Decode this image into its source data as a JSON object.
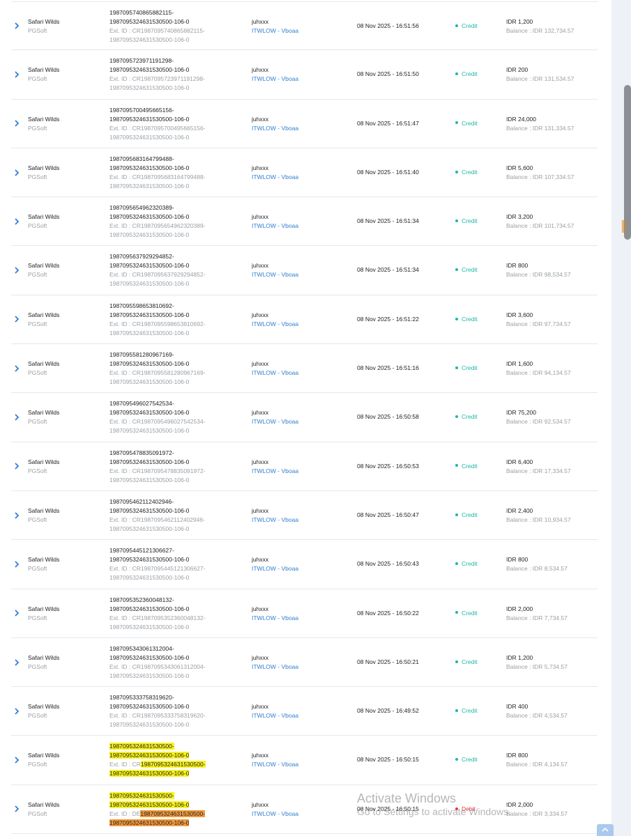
{
  "transactions": [
    {
      "game": "Safari Wilds",
      "provider": "PGSoft",
      "tx_id_1": "1987095740865882115-",
      "tx_id_2": "1987095324631530500-106-0",
      "ext_prefix": "Ext. ID : ",
      "ext_1": "CR1987095740865882115-",
      "ext_2": "1987095324631530500-106-0",
      "user": "juhxxx",
      "agent": "ITWLOW - Vboaa",
      "date": "08 Nov 2025 - 16:51:56",
      "type": "Credit",
      "amount": "IDR 1,200",
      "balance": "Balance : IDR 132,734.57"
    },
    {
      "game": "Safari Wilds",
      "provider": "PGSoft",
      "tx_id_1": "1987095723971191298-",
      "tx_id_2": "1987095324631530500-106-0",
      "ext_prefix": "Ext. ID : ",
      "ext_1": "CR1987095723971191298-",
      "ext_2": "1987095324631530500-106-0",
      "user": "juhxxx",
      "agent": "ITWLOW - Vboaa",
      "date": "08 Nov 2025 - 16:51:50",
      "type": "Credit",
      "amount": "IDR 200",
      "balance": "Balance : IDR 131,534.57"
    },
    {
      "game": "Safari Wilds",
      "provider": "PGSoft",
      "tx_id_1": "1987095700495665156-",
      "tx_id_2": "1987095324631530500-106-0",
      "ext_prefix": "Ext. ID : ",
      "ext_1": "CR1987095700495665156-",
      "ext_2": "1987095324631530500-106-0",
      "user": "juhxxx",
      "agent": "ITWLOW - Vboaa",
      "date": "08 Nov 2025 - 16:51:47",
      "type": "Credit",
      "amount": "IDR 24,000",
      "balance": "Balance : IDR 131,334.57"
    },
    {
      "game": "Safari Wilds",
      "provider": "PGSoft",
      "tx_id_1": "1987095683164799488-",
      "tx_id_2": "1987095324631530500-106-0",
      "ext_prefix": "Ext. ID : ",
      "ext_1": "CR1987095683164799488-",
      "ext_2": "1987095324631530500-106-0",
      "user": "juhxxx",
      "agent": "ITWLOW - Vboaa",
      "date": "08 Nov 2025 - 16:51:40",
      "type": "Credit",
      "amount": "IDR 5,600",
      "balance": "Balance : IDR 107,334.57"
    },
    {
      "game": "Safari Wilds",
      "provider": "PGSoft",
      "tx_id_1": "1987095654962320389-",
      "tx_id_2": "1987095324631530500-106-0",
      "ext_prefix": "Ext. ID : ",
      "ext_1": "CR1987095654962320389-",
      "ext_2": "1987095324631530500-106-0",
      "user": "juhxxx",
      "agent": "ITWLOW - Vboaa",
      "date": "08 Nov 2025 - 16:51:34",
      "type": "Credit",
      "amount": "IDR 3,200",
      "balance": "Balance : IDR 101,734.57"
    },
    {
      "game": "Safari Wilds",
      "provider": "PGSoft",
      "tx_id_1": "1987095637929294852-",
      "tx_id_2": "1987095324631530500-106-0",
      "ext_prefix": "Ext. ID : ",
      "ext_1": "CR1987095637929294852-",
      "ext_2": "1987095324631530500-106-0",
      "user": "juhxxx",
      "agent": "ITWLOW - Vboaa",
      "date": "08 Nov 2025 - 16:51:34",
      "type": "Credit",
      "amount": "IDR 800",
      "balance": "Balance : IDR 98,534.57"
    },
    {
      "game": "Safari Wilds",
      "provider": "PGSoft",
      "tx_id_1": "1987095598653810692-",
      "tx_id_2": "1987095324631530500-106-0",
      "ext_prefix": "Ext. ID : ",
      "ext_1": "CR1987095598653810692-",
      "ext_2": "1987095324631530500-106-0",
      "user": "juhxxx",
      "agent": "ITWLOW - Vboaa",
      "date": "08 Nov 2025 - 16:51:22",
      "type": "Credit",
      "amount": "IDR 3,600",
      "balance": "Balance : IDR 97,734.57"
    },
    {
      "game": "Safari Wilds",
      "provider": "PGSoft",
      "tx_id_1": "1987095581280967169-",
      "tx_id_2": "1987095324631530500-106-0",
      "ext_prefix": "Ext. ID : ",
      "ext_1": "CR1987095581280967169-",
      "ext_2": "1987095324631530500-106-0",
      "user": "juhxxx",
      "agent": "ITWLOW - Vboaa",
      "date": "08 Nov 2025 - 16:51:16",
      "type": "Credit",
      "amount": "IDR 1,600",
      "balance": "Balance : IDR 94,134.57"
    },
    {
      "game": "Safari Wilds",
      "provider": "PGSoft",
      "tx_id_1": "1987095496027542534-",
      "tx_id_2": "1987095324631530500-106-0",
      "ext_prefix": "Ext. ID : ",
      "ext_1": "CR1987095496027542534-",
      "ext_2": "1987095324631530500-106-0",
      "user": "juhxxx",
      "agent": "ITWLOW - Vboaa",
      "date": "08 Nov 2025 - 16:50:58",
      "type": "Credit",
      "amount": "IDR 75,200",
      "balance": "Balance : IDR 92,534.57"
    },
    {
      "game": "Safari Wilds",
      "provider": "PGSoft",
      "tx_id_1": "1987095478835091972-",
      "tx_id_2": "1987095324631530500-106-0",
      "ext_prefix": "Ext. ID : ",
      "ext_1": "CR1987095478835091972-",
      "ext_2": "1987095324631530500-106-0",
      "user": "juhxxx",
      "agent": "ITWLOW - Vboaa",
      "date": "08 Nov 2025 - 16:50:53",
      "type": "Credit",
      "amount": "IDR 6,400",
      "balance": "Balance : IDR 17,334.57"
    },
    {
      "game": "Safari Wilds",
      "provider": "PGSoft",
      "tx_id_1": "1987095462112402946-",
      "tx_id_2": "1987095324631530500-106-0",
      "ext_prefix": "Ext. ID : ",
      "ext_1": "CR1987095462112402946-",
      "ext_2": "1987095324631530500-106-0",
      "user": "juhxxx",
      "agent": "ITWLOW - Vboaa",
      "date": "08 Nov 2025 - 16:50:47",
      "type": "Credit",
      "amount": "IDR 2,400",
      "balance": "Balance : IDR 10,934.57"
    },
    {
      "game": "Safari Wilds",
      "provider": "PGSoft",
      "tx_id_1": "1987095445121306627-",
      "tx_id_2": "1987095324631530500-106-0",
      "ext_prefix": "Ext. ID : ",
      "ext_1": "CR1987095445121306627-",
      "ext_2": "1987095324631530500-106-0",
      "user": "juhxxx",
      "agent": "ITWLOW - Vboaa",
      "date": "08 Nov 2025 - 16:50:43",
      "type": "Credit",
      "amount": "IDR 800",
      "balance": "Balance : IDR 8,534.57"
    },
    {
      "game": "Safari Wilds",
      "provider": "PGSoft",
      "tx_id_1": "1987095352360048132-",
      "tx_id_2": "1987095324631530500-106-0",
      "ext_prefix": "Ext. ID : ",
      "ext_1": "CR1987095352360048132-",
      "ext_2": "1987095324631530500-106-0",
      "user": "juhxxx",
      "agent": "ITWLOW - Vboaa",
      "date": "08 Nov 2025 - 16:50:22",
      "type": "Credit",
      "amount": "IDR 2,000",
      "balance": "Balance : IDR 7,734.57"
    },
    {
      "game": "Safari Wilds",
      "provider": "PGSoft",
      "tx_id_1": "1987095343061312004-",
      "tx_id_2": "1987095324631530500-106-0",
      "ext_prefix": "Ext. ID : ",
      "ext_1": "CR1987095343061312004-",
      "ext_2": "1987095324631530500-106-0",
      "user": "juhxxx",
      "agent": "ITWLOW - Vboaa",
      "date": "08 Nov 2025 - 16:50:21",
      "type": "Credit",
      "amount": "IDR 1,200",
      "balance": "Balance : IDR 5,734.57"
    },
    {
      "game": "Safari Wilds",
      "provider": "PGSoft",
      "tx_id_1": "1987095333758319620-",
      "tx_id_2": "1987095324631530500-106-0",
      "ext_prefix": "Ext. ID : ",
      "ext_1": "CR1987095333758319620-",
      "ext_2": "1987095324631530500-106-0",
      "user": "juhxxx",
      "agent": "ITWLOW - Vboaa",
      "date": "08 Nov 2025 - 16:49:52",
      "type": "Credit",
      "amount": "IDR 400",
      "balance": "Balance : IDR 4,534.57"
    },
    {
      "game": "Safari Wilds",
      "provider": "PGSoft",
      "tx_id_1": "1987095324631530500-",
      "tx_id_2": "1987095324631530500-106-0",
      "ext_prefix": "Ext. ID : CR",
      "ext_1": "1987095324631530500-",
      "ext_2": "1987095324631530500-106-0",
      "user": "juhxxx",
      "agent": "ITWLOW - Vboaa",
      "date": "08 Nov 2025 - 16:50:15",
      "type": "Credit",
      "amount": "IDR 800",
      "balance": "Balance : IDR 4,134.57",
      "highlight": "yellow"
    },
    {
      "game": "Safari Wilds",
      "provider": "PGSoft",
      "tx_id_1": "1987095324631530500-",
      "tx_id_2": "1987095324631530500-106-0",
      "ext_prefix": "Ext. ID : DE",
      "ext_1": "1987095324631530500-",
      "ext_2": "1987095324631530500-106-0",
      "user": "juhxxx",
      "agent": "ITWLOW - Vboaa",
      "date": "08 Nov 2025 - 16:50:15",
      "type": "Debit",
      "amount": "IDR 2,000",
      "balance": "Balance : IDR 3,334.57",
      "highlight": "orange"
    }
  ],
  "watermark": {
    "line1": "Activate Windows",
    "line2": "Go to Settings to activate Windows."
  },
  "colors": {
    "credit": "#1bb8a6",
    "debit": "#e8363c",
    "link": "#2f7fd1",
    "highlight_yellow": "#f7f21d",
    "highlight_orange": "#f39a3d"
  },
  "icons": {
    "row_toggle": "chevron-right-icon",
    "back_to_top": "chevron-up-icon"
  }
}
